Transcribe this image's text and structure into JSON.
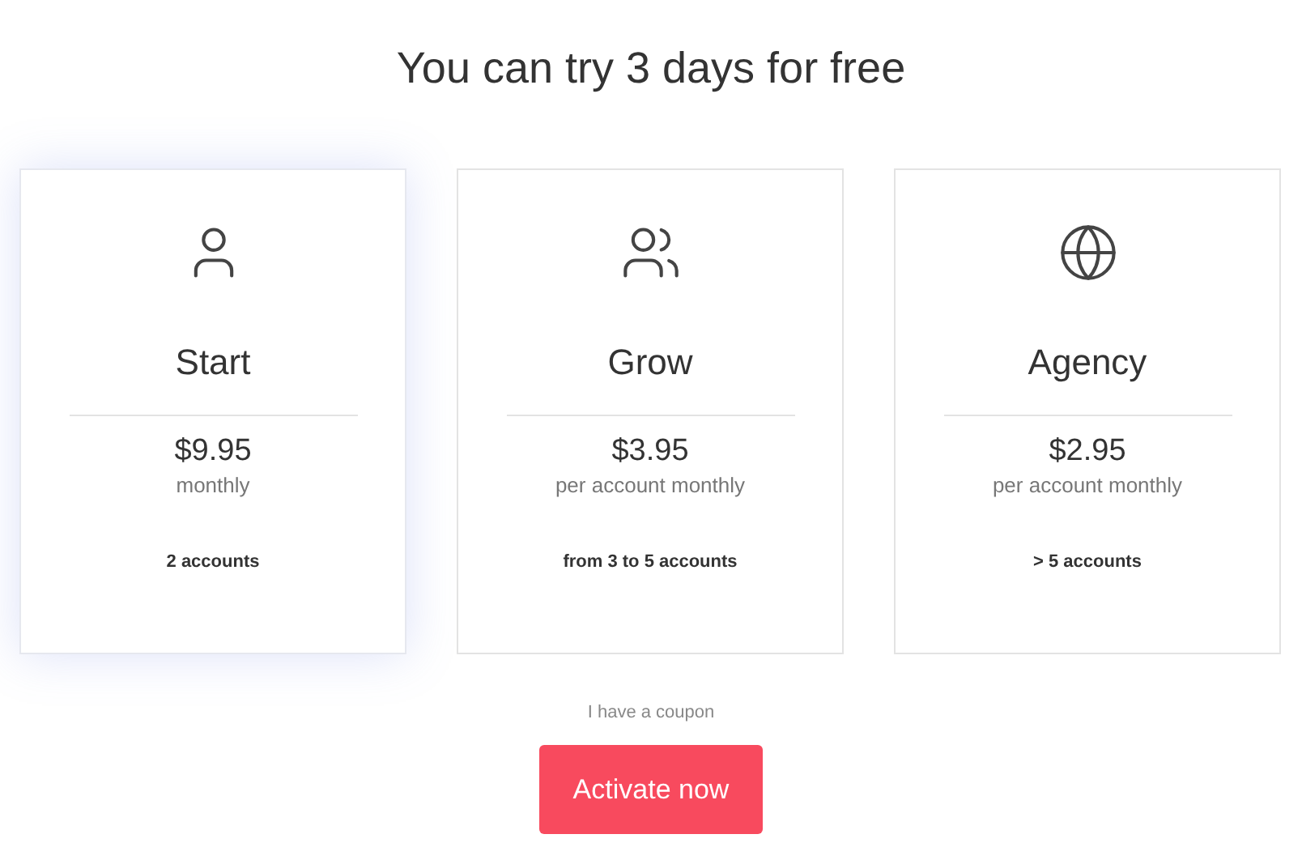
{
  "title": "You can try 3 days for free",
  "plans": [
    {
      "kind": "user",
      "name": "Start",
      "price": "$9.95",
      "period": "monthly",
      "accounts": "2 accounts",
      "selected": true
    },
    {
      "kind": "users",
      "name": "Grow",
      "price": "$3.95",
      "period": "per account monthly",
      "accounts": "from 3 to 5 accounts",
      "selected": false
    },
    {
      "kind": "globe",
      "name": "Agency",
      "price": "$2.95",
      "period": "per account monthly",
      "accounts": "> 5 accounts",
      "selected": false
    }
  ],
  "coupon_link": "I have a coupon",
  "activate_button": "Activate now"
}
